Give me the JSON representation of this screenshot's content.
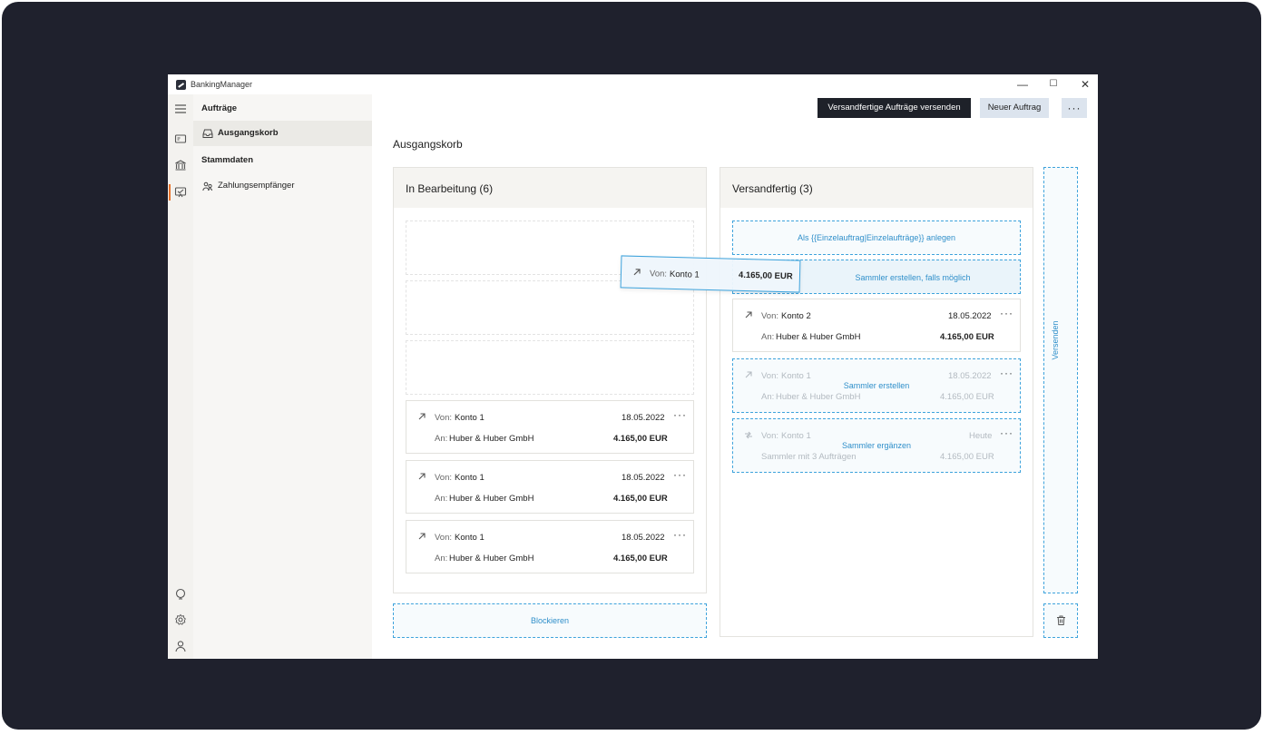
{
  "app": {
    "title": "BankingManager"
  },
  "window_controls": {
    "minimize": "—",
    "maximize": "☐",
    "close": "✕"
  },
  "sidebar": {
    "group_orders": "Aufträge",
    "item_outbox": "Ausgangskorb",
    "group_master": "Stammdaten",
    "item_payees": "Zahlungsempfänger"
  },
  "toolbar": {
    "send_ready": "Versandfertige Aufträge versenden",
    "new_order": "Neuer Auftrag",
    "more": "···"
  },
  "page": {
    "title": "Ausgangskorb"
  },
  "in_progress": {
    "title": "In Bearbeitung (6)",
    "cards": [
      {
        "from_label": "Von:",
        "from": "Konto 1",
        "date": "18.05.2022",
        "to_label": "An:",
        "to": "Huber & Huber GmbH",
        "amount": "4.165,00 EUR",
        "menu": "···"
      },
      {
        "from_label": "Von:",
        "from": "Konto 1",
        "date": "18.05.2022",
        "to_label": "An:",
        "to": "Huber & Huber GmbH",
        "amount": "4.165,00 EUR",
        "menu": "···"
      },
      {
        "from_label": "Von:",
        "from": "Konto 1",
        "date": "18.05.2022",
        "to_label": "An:",
        "to": "Huber & Huber GmbH",
        "amount": "4.165,00 EUR",
        "menu": "···"
      }
    ]
  },
  "ready": {
    "title": "Versandfertig (3)",
    "drop_single": "Als {{Einzelauftrag|Einzelaufträge}} anlegen",
    "drop_collector_possible": "Sammler erstellen, falls möglich",
    "card_main": {
      "from_label": "Von:",
      "from": "Konto 2",
      "date": "18.05.2022",
      "to_label": "An:",
      "to": "Huber & Huber GmbH",
      "amount": "4.165,00 EUR",
      "menu": "···"
    },
    "card_collect": {
      "from_label": "Von:",
      "from": "Konto 1",
      "date": "18.05.2022",
      "to_label": "An:",
      "to": "Huber & Huber GmbH",
      "amount": "4.165,00 EUR",
      "menu": "···",
      "drop": "Sammler erstellen"
    },
    "card_extend": {
      "from_label": "Von:",
      "from": "Konto 1",
      "date": "Heute",
      "subtitle": "Sammler mit 3 Aufträgen",
      "amount": "4.165,00 EUR",
      "menu": "···",
      "drop": "Sammler ergänzen"
    }
  },
  "drag": {
    "from_label": "Von:",
    "from": "Konto 1",
    "amount": "4.165,00 EUR"
  },
  "zones": {
    "block": "Blockieren",
    "send": "Versenden"
  },
  "icons": {
    "menu": "hamburger-icon",
    "orders": "orders-icon",
    "bank": "bank-icon",
    "outbox": "outbox-icon",
    "help": "help-icon",
    "settings": "gear-icon",
    "user": "user-icon",
    "trash": "trash-icon",
    "arrow": "arrow-up-right-icon",
    "collector": "collector-icon"
  },
  "colors": {
    "accent": "#3ea3dc",
    "active_marker": "#e8732b",
    "primary_button": "#1e2129",
    "secondary_button": "#dce4ee"
  }
}
